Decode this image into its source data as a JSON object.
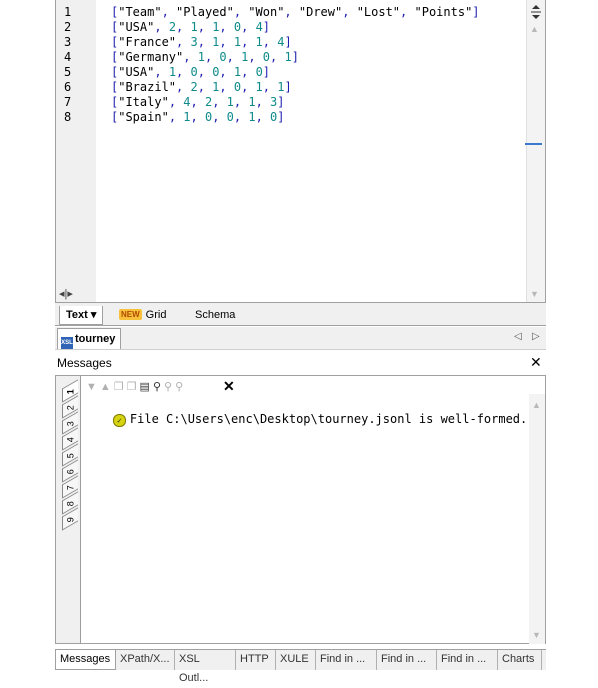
{
  "editor": {
    "line_numbers": [
      "1",
      "2",
      "3",
      "4",
      "5",
      "6",
      "7",
      "8"
    ],
    "lines": [
      [
        "\"Team\"",
        "\"Played\"",
        "\"Won\"",
        "\"Drew\"",
        "\"Lost\"",
        "\"Points\""
      ],
      [
        "\"USA\"",
        "2",
        "1",
        "1",
        "0",
        "4"
      ],
      [
        "\"France\"",
        "3",
        "1",
        "1",
        "1",
        "4"
      ],
      [
        "\"Germany\"",
        "1",
        "0",
        "1",
        "0",
        "1"
      ],
      [
        "\"USA\"",
        "1",
        "0",
        "0",
        "1",
        "0"
      ],
      [
        "\"Brazil\"",
        "2",
        "1",
        "0",
        "1",
        "1"
      ],
      [
        "\"Italy\"",
        "4",
        "2",
        "1",
        "1",
        "3"
      ],
      [
        "\"Spain\"",
        "1",
        "0",
        "0",
        "1",
        "0"
      ]
    ]
  },
  "view_tabs": {
    "text": "Text",
    "text_arrow": "▾",
    "new_badge": "NEW",
    "grid": "Grid",
    "schema": "Schema"
  },
  "document_tab": {
    "icon_text": "XSL",
    "label": "tourney"
  },
  "messages": {
    "title": "Messages",
    "close": "✕",
    "vertical_tabs": [
      "1",
      "2",
      "3",
      "4",
      "5",
      "6",
      "7",
      "8",
      "9"
    ],
    "message_text": "File C:\\Users\\enc\\Desktop\\tourney.jsonl is well-formed."
  },
  "bottom_tabs": [
    "Messages",
    "XPath/X...",
    "XSL Outl...",
    "HTTP",
    "XULE",
    "Find in ...",
    "Find in ...",
    "Find in ...",
    "Charts"
  ],
  "colors": {
    "string": "#000000",
    "number": "#0e8a8a",
    "punct": "#1d1db0",
    "accent": "#3b78d0"
  }
}
